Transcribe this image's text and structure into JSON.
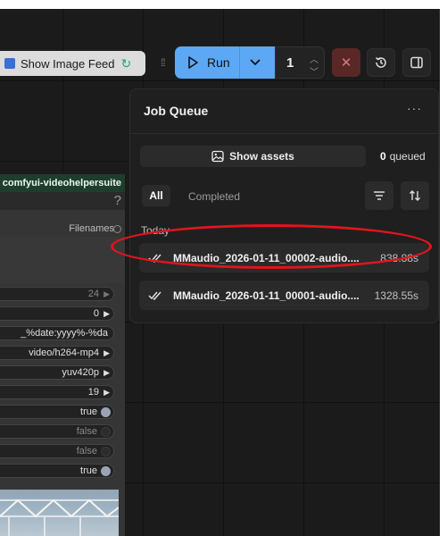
{
  "toolbar": {
    "image_feed_label": "Show Image Feed",
    "run_label": "Run",
    "batch_count": "1"
  },
  "node": {
    "title": "comfyui-videohelpersuite",
    "help": "?",
    "filenames_label": "Filenames",
    "widgets": [
      "24",
      "0",
      "_%date:yyyy%-%da",
      "video/h264-mp4",
      "yuv420p",
      "19",
      "true",
      "false",
      "false",
      "true"
    ]
  },
  "queue": {
    "title": "Job Queue",
    "more": "···",
    "show_assets_label": "Show assets",
    "queued_count": "0",
    "queued_label": "queued",
    "tabs": [
      "All",
      "Completed"
    ],
    "group_label": "Today",
    "jobs": [
      {
        "name": "MMaudio_2026-01-11_00002-audio....",
        "duration": "838.88s"
      },
      {
        "name": "MMaudio_2026-01-11_00001-audio....",
        "duration": "1328.55s"
      }
    ]
  },
  "colors": {
    "run_accent": "#5da8f5",
    "annotation_circle": "#e2141d",
    "stop_bg": "#5a2727"
  }
}
